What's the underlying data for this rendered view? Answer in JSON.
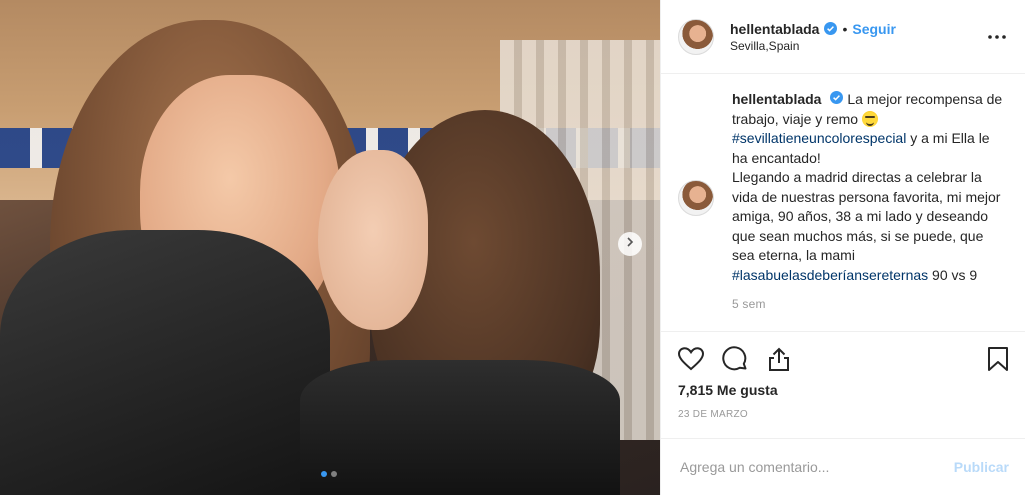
{
  "post": {
    "photo": {
      "alt": "",
      "carousel": {
        "slide_count": 2,
        "active_slide": 1
      }
    },
    "header": {
      "username": "hellentablada",
      "separator": "•",
      "follow_label": "Seguir",
      "location": "Sevilla,Spain"
    },
    "caption": {
      "username": "hellentablada",
      "text_1": "La mejor recompensa de trabajo, viaje y remo",
      "hashtag_1": "#sevillatieneuncolorespecial",
      "text_2": "y a mi Ella le ha encantado!",
      "text_3": "Llegando a madrid directas a celebrar la vida de nuestras persona favorita, mi mejor amiga, 90 años, 38 a mi lado y deseando que sean muchos más, si se puede, que sea eterna, la mami",
      "hashtag_2": "#lasabuelasdeberíansereternas",
      "text_4": "90 vs 9",
      "time": "5 sem"
    },
    "stats": {
      "likes": "7,815 Me gusta",
      "date": "23 DE MARZO"
    },
    "comment_box": {
      "placeholder": "Agrega un comentario...",
      "publish_label": "Publicar"
    },
    "icons": {
      "verified": "verified-badge-icon",
      "more": "more-options-icon",
      "like": "heart-icon",
      "comment": "comment-icon",
      "share": "share-icon",
      "save": "bookmark-icon",
      "next": "chevron-right-icon"
    },
    "colors": {
      "link": "#3897f0",
      "hashtag": "#003569",
      "muted": "#999999",
      "border": "#efefef",
      "text": "#262626"
    }
  }
}
